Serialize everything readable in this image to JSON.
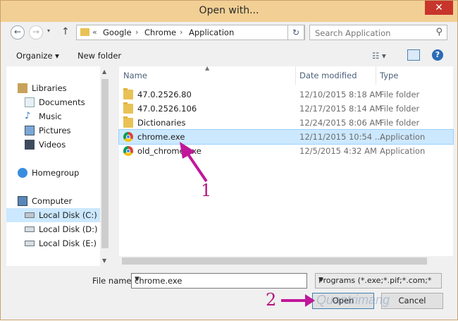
{
  "window": {
    "title": "Open with...",
    "close_glyph": "✕"
  },
  "nav": {
    "back_glyph": "←",
    "forward_glyph": "→",
    "up_glyph": "↑"
  },
  "address": {
    "overflow": "«",
    "crumbs": [
      "Google",
      "Chrome",
      "Application"
    ],
    "separator": "›",
    "dropdown_glyph": "⌄",
    "refresh_glyph": "↻"
  },
  "search": {
    "placeholder": "Search Application",
    "icon": "search-icon"
  },
  "toolbar": {
    "organize": "Organize ▾",
    "new_folder": "New folder",
    "view_glyph": "☷ ▾",
    "help_glyph": "?"
  },
  "sidebar": {
    "items": [
      {
        "label": "Libraries",
        "icon": "libraries-icon"
      },
      {
        "label": "Documents",
        "icon": "documents-icon"
      },
      {
        "label": "Music",
        "icon": "music-icon"
      },
      {
        "label": "Pictures",
        "icon": "pictures-icon"
      },
      {
        "label": "Videos",
        "icon": "videos-icon"
      },
      {
        "label": "Homegroup",
        "icon": "homegroup-icon"
      },
      {
        "label": "Computer",
        "icon": "computer-icon"
      },
      {
        "label": "Local Disk (C:)",
        "icon": "drive-icon",
        "selected": true
      },
      {
        "label": "Local Disk (D:)",
        "icon": "drive-icon"
      },
      {
        "label": "Local Disk (E:)",
        "icon": "drive-icon"
      }
    ]
  },
  "columns": {
    "name": "Name",
    "date": "Date modified",
    "type": "Type"
  },
  "files": [
    {
      "name": "47.0.2526.80",
      "date": "12/10/2015 8:18 AM",
      "type": "File folder",
      "kind": "folder"
    },
    {
      "name": "47.0.2526.106",
      "date": "12/17/2015 8:14 AM",
      "type": "File folder",
      "kind": "folder"
    },
    {
      "name": "Dictionaries",
      "date": "12/24/2015 8:06 AM",
      "type": "File folder",
      "kind": "folder"
    },
    {
      "name": "chrome.exe",
      "date": "12/11/2015 10:54 ...",
      "type": "Application",
      "kind": "chrome",
      "selected": true
    },
    {
      "name": "old_chrome.exe",
      "date": "12/5/2015 4:32 AM",
      "type": "Application",
      "kind": "chrome"
    }
  ],
  "footer": {
    "file_name_label": "File name:",
    "file_name_value": "chrome.exe",
    "filter_value": "Programs (*.exe;*.pif;*.com;*.ba",
    "open_label": "Open",
    "cancel_label": "Cancel"
  },
  "annotations": {
    "step1": "1",
    "step2": "2",
    "arrow_color": "#c0179a"
  },
  "watermark": "Quantrimang"
}
